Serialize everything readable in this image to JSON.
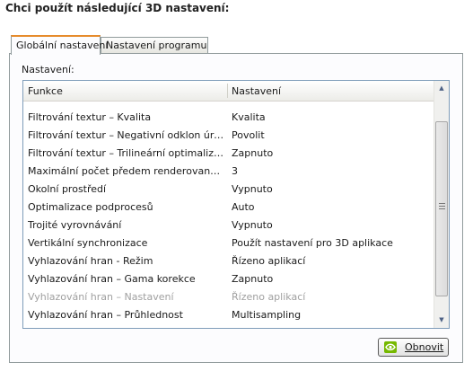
{
  "header": {
    "title": "Chci použít následující 3D nastavení:"
  },
  "tabs": [
    {
      "label": "Globální nastavení",
      "active": true
    },
    {
      "label": "Nastavení programu",
      "active": false
    }
  ],
  "panel": {
    "settings_label": "Nastavení:",
    "columns": {
      "feature": "Funkce",
      "setting": "Nastavení"
    },
    "rows": [
      {
        "feature": "Filtrování textur – Kvalita",
        "setting": "Kvalita",
        "disabled": false
      },
      {
        "feature": "Filtrování textur – Negativní odklon úrovn...",
        "setting": "Povolit",
        "disabled": false
      },
      {
        "feature": "Filtrování textur – Trilineární optimalizace",
        "setting": "Zapnuto",
        "disabled": false
      },
      {
        "feature": "Maximální počet předem renderovaných s...",
        "setting": "3",
        "disabled": false
      },
      {
        "feature": "Okolní prostředí",
        "setting": "Vypnuto",
        "disabled": false
      },
      {
        "feature": "Optimalizace podprocesů",
        "setting": "Auto",
        "disabled": false
      },
      {
        "feature": "Trojité vyrovnávání",
        "setting": "Vypnuto",
        "disabled": false
      },
      {
        "feature": "Vertikální synchronizace",
        "setting": "Použít nastavení pro 3D aplikace",
        "disabled": false
      },
      {
        "feature": "Vyhlazování hran - Režim",
        "setting": "Řízeno aplikací",
        "disabled": false
      },
      {
        "feature": "Vyhlazování hran – Gama korekce",
        "setting": "Zapnuto",
        "disabled": false
      },
      {
        "feature": "Vyhlazování hran – Nastavení",
        "setting": "Řízeno aplikací",
        "disabled": true
      },
      {
        "feature": "Vyhlazování hran – Průhlednost",
        "setting": "Multisampling",
        "disabled": false
      }
    ],
    "restore_button": "Obnovit"
  },
  "colors": {
    "accent_tab": "#e68b2c",
    "nvidia_green": "#76b900",
    "disabled_text": "#a0a0a0"
  },
  "icons": {
    "restore_button_icon": "nvidia-logo-icon",
    "scroll_up": "arrow-up-icon",
    "scroll_down": "arrow-down-icon"
  }
}
